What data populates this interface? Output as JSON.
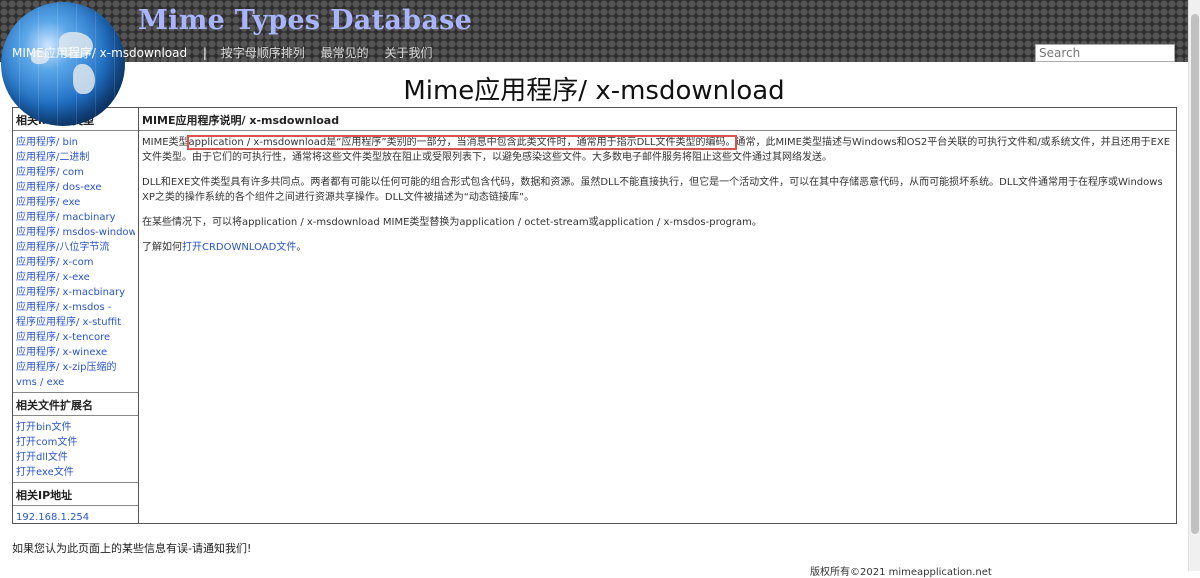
{
  "header": {
    "site_title": "Mime Types Database",
    "nav": {
      "current": "MIME应用程序/ x-msdownload",
      "separator": "|",
      "links": [
        "按字母顺序排列",
        "最常见的",
        "关于我们"
      ]
    },
    "search_placeholder": "Search"
  },
  "page_title": "Mime应用程序/ x-msdownload",
  "sidebar": {
    "related_types_heading": "相关mime类型",
    "related_types": [
      "应用程序/ bin",
      "应用程序/二进制",
      "应用程序/ com",
      "应用程序/ dos-exe",
      "应用程序/ exe",
      "应用程序/ macbinary",
      "应用程序/ msdos-windows",
      "应用程序/八位字节流",
      "应用程序/ x-com",
      "应用程序/ x-exe",
      "应用程序/ x-macbinary",
      "应用程序/ x-msdos -",
      "程序应用程序/ x-stuffit",
      "应用程序/ x-tencore",
      "应用程序/ x-winexe",
      "应用程序/ x-zip压缩的",
      "vms / exe"
    ],
    "related_ext_heading": "相关文件扩展名",
    "related_ext": [
      "打开bin文件",
      "打开com文件",
      "打开dll文件",
      "打开exe文件"
    ],
    "ip_heading": "相关IP地址",
    "ip_value": "192.168.1.254"
  },
  "main": {
    "heading": "MIME应用程序说明/ x-msdownload",
    "p1_prefix": "MIME类型",
    "p1_highlight": "application / x-msdownload是“应用程序”类别的一部分，当消息中包含此类文件时，通常用于指示DLL文件类型的编码。",
    "p1_rest": "通常，此MIME类型描述与Windows和OS2平台关联的可执行文件和/或系统文件，并且还用于EXE文件类型。由于它们的可执行性，通常将这些文件类型放在阻止或受限列表下，以避免感染这些文件。大多数电子邮件服务将阻止这些文件通过其网络发送。",
    "p2": "DLL和EXE文件类型具有许多共同点。两者都有可能以任何可能的组合形式包含代码，数据和资源。虽然DLL不能直接执行，但它是一个活动文件，可以在其中存储恶意代码，从而可能损坏系统。DLL文件通常用于在程序或Windows XP之类的操作系统的各个组件之间进行资源共享操作。DLL文件被描述为“动态链接库”。",
    "p3": "在某些情况下，可以将application / x-msdownload MIME类型替换为application / octet-stream或application / x-msdos-program。",
    "p4_prefix": "了解如何",
    "p4_link": "打开CRDOWNLOAD文件",
    "p4_suffix": "。"
  },
  "footer": {
    "note": "如果您认为此页面上的某些信息有误-请通知我们!",
    "copyright": "版权所有©2021 mimeapplication.net"
  }
}
